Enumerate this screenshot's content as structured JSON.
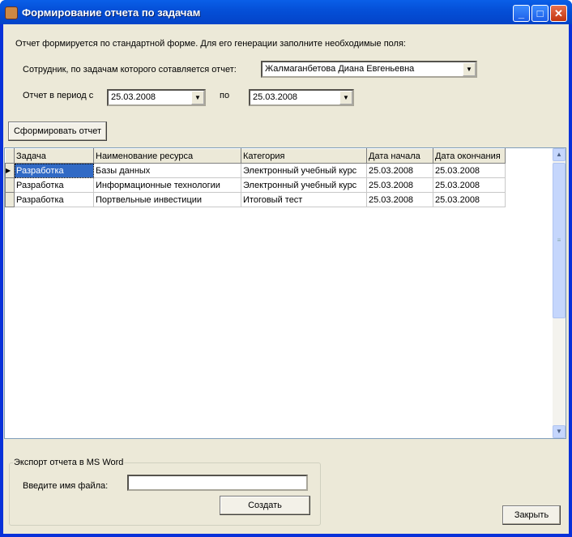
{
  "window": {
    "title": "Формирование отчета по задачам",
    "minimize": "_",
    "maximize": "□",
    "close": "✕"
  },
  "intro": "Отчет формируется по стандартной форме. Для его генерации заполните необходимые поля:",
  "employee": {
    "label": "Сотрудник, по задачам которого сотавляется отчет:",
    "value": "Жалмаганбетова Диана Евгеньевна"
  },
  "period": {
    "from_label": "Отчет в период с",
    "from_value": "25.03.2008",
    "to_label": "по",
    "to_value": "25.03.2008"
  },
  "generate_button": "Сформировать отчет",
  "table": {
    "columns": [
      "Задача",
      "Наименование ресурса",
      "Категория",
      "Дата начала",
      "Дата окончания"
    ],
    "rows": [
      [
        "Разработка",
        "Базы данных",
        "Электронный учебный курс",
        "25.03.2008",
        "25.03.2008"
      ],
      [
        "Разработка",
        "Информационные технологии",
        "Электронный учебный курс",
        "25.03.2008",
        "25.03.2008"
      ],
      [
        "Разработка",
        "Портвельные инвестиции",
        "Итоговый тест",
        "25.03.2008",
        "25.03.2008"
      ]
    ]
  },
  "export": {
    "legend": "Экспорт отчета в MS Word",
    "file_label": "Введите имя файла:",
    "file_value": "",
    "create_button": "Создать"
  },
  "close_button": "Закрыть"
}
